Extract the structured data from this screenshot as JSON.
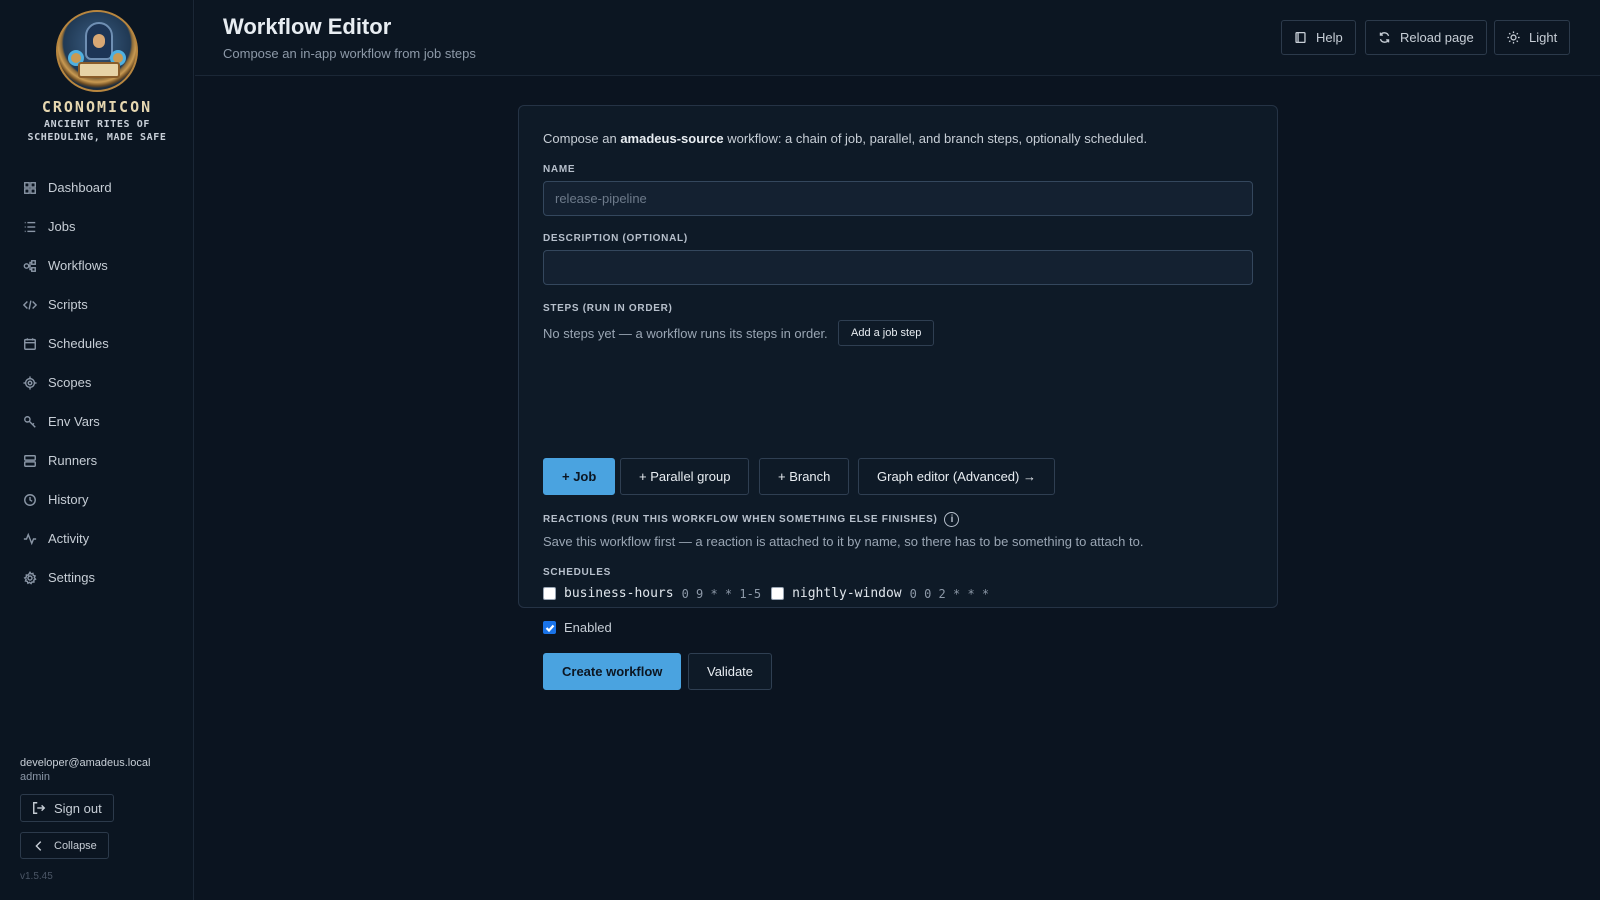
{
  "sidebar": {
    "brand": "CRONOMICON",
    "tagline_line1": "ANCIENT RITES OF",
    "tagline_line2": "SCHEDULING, MADE SAFE",
    "items": [
      {
        "label": "Dashboard",
        "icon": "grid-icon"
      },
      {
        "label": "Jobs",
        "icon": "list-icon"
      },
      {
        "label": "Workflows",
        "icon": "workflow-icon"
      },
      {
        "label": "Scripts",
        "icon": "code-icon"
      },
      {
        "label": "Schedules",
        "icon": "calendar-icon"
      },
      {
        "label": "Scopes",
        "icon": "target-icon"
      },
      {
        "label": "Env Vars",
        "icon": "key-icon"
      },
      {
        "label": "Runners",
        "icon": "server-icon"
      },
      {
        "label": "History",
        "icon": "clock-icon"
      },
      {
        "label": "Activity",
        "icon": "activity-icon"
      },
      {
        "label": "Settings",
        "icon": "gear-icon"
      }
    ],
    "user_email": "developer@amadeus.local",
    "user_role": "admin",
    "sign_out_label": "Sign out",
    "collapse_label": "Collapse",
    "version": "v1.5.45"
  },
  "header": {
    "title": "Workflow Editor",
    "subtitle": "Compose an in-app workflow from job steps",
    "help_label": "Help",
    "reload_label": "Reload page",
    "theme_label": "Light"
  },
  "form": {
    "intro_prefix": "Compose an ",
    "intro_source": "amadeus-source",
    "intro_suffix": " workflow: a chain of job, parallel, and branch steps, optionally scheduled.",
    "name_label": "NAME",
    "name_placeholder": "release-pipeline",
    "name_value": "",
    "description_label": "DESCRIPTION (OPTIONAL)",
    "description_value": "",
    "steps_label": "STEPS (RUN IN ORDER)",
    "steps_empty": "No steps yet — a workflow runs its steps in order.",
    "add_job_step_label": "Add a job step",
    "step_buttons": {
      "job": "+ Job",
      "parallel": "+ Parallel group",
      "branch": "+ Branch",
      "graph": "Graph editor (Advanced) →"
    },
    "reactions_label": "REACTIONS (RUN THIS WORKFLOW WHEN SOMETHING ELSE FINISHES)",
    "reactions_info_glyph": "i",
    "reactions_text": "Save this workflow first — a reaction is attached to it by name, so there has to be something to attach to.",
    "schedules_label": "SCHEDULES",
    "schedules": [
      {
        "name": "business-hours",
        "cron": "0 9 * * 1-5",
        "checked": false
      },
      {
        "name": "nightly-window",
        "cron": "0 0 2 * * *",
        "checked": false
      }
    ],
    "enabled_label": "Enabled",
    "enabled_checked": true,
    "create_label": "Create workflow",
    "validate_label": "Validate"
  },
  "colors": {
    "accent": "#4aa3e0",
    "background": "#0b1420",
    "card": "#0e1a27",
    "checkbox_checked": "#1a73e8"
  }
}
